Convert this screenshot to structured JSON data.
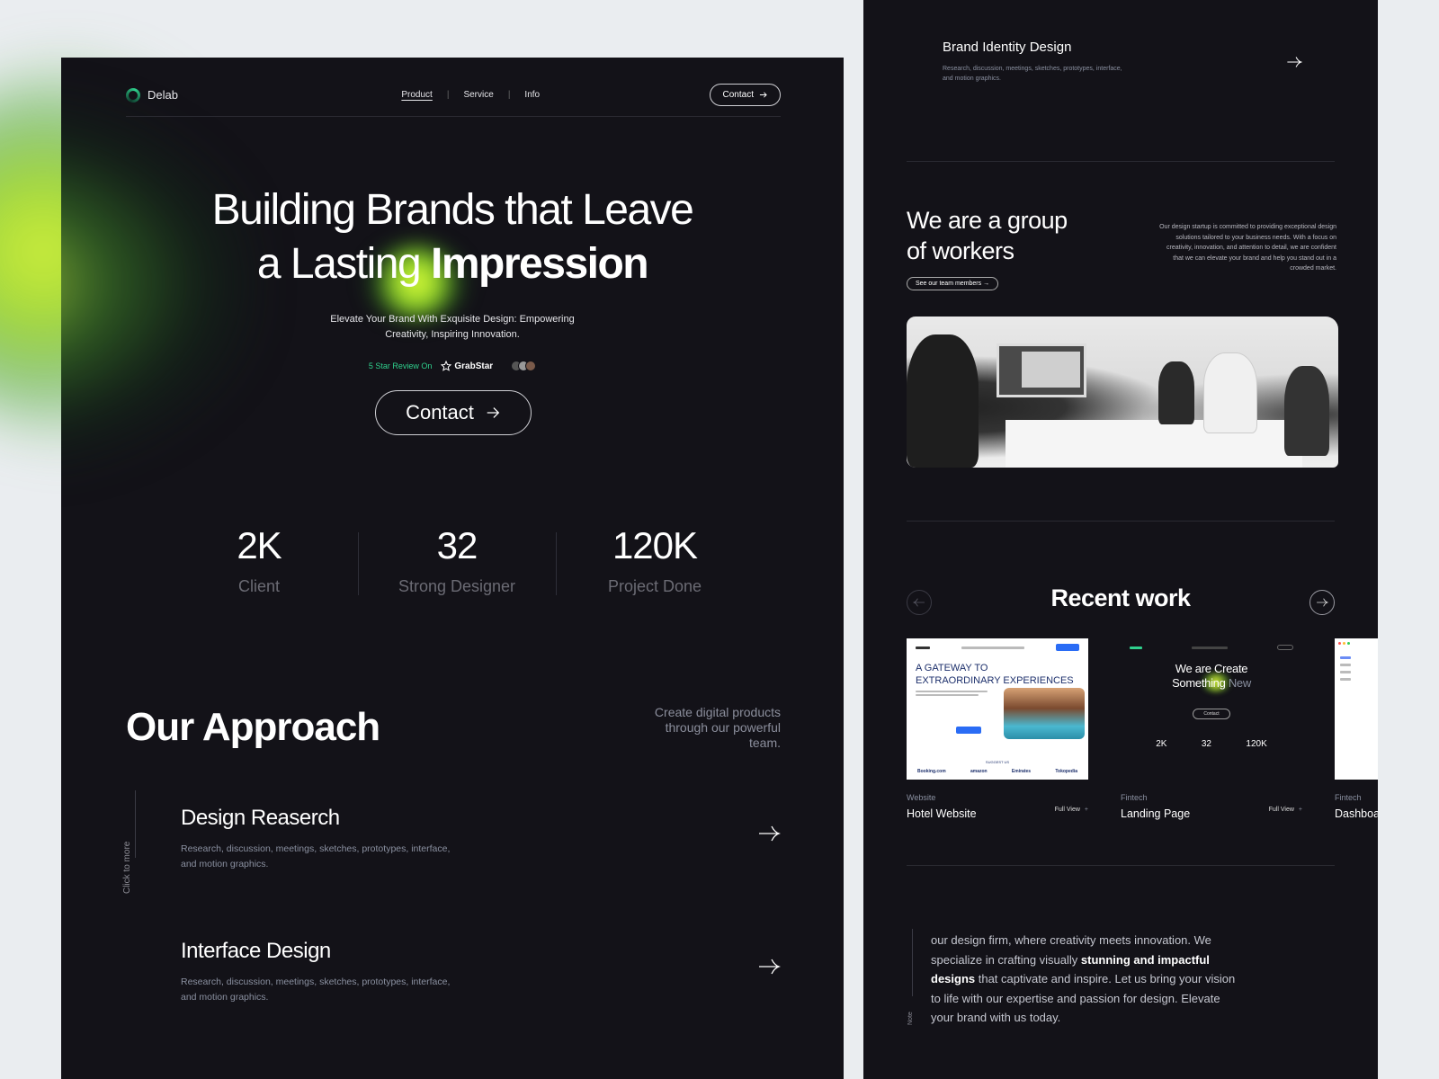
{
  "left_page": {
    "nav": {
      "brand": "Delab",
      "links": [
        {
          "label": "Product",
          "active": true
        },
        {
          "label": "Service",
          "active": false
        },
        {
          "label": "Info",
          "active": false
        }
      ],
      "separator": "|",
      "contact_label": "Contact",
      "contact_icon": "arrow-right-icon"
    },
    "hero": {
      "title_line1": "Building Brands that Leave",
      "title_line2_prefix": "a Lasting ",
      "title_line2_bold": "Impression",
      "subtitle_line1": "Elevate Your Brand With Exquisite Design: Empowering",
      "subtitle_line2": "Creativity, Inspiring Innovation.",
      "review_label": "5 Star Review On",
      "review_brand": "GrabStar",
      "contact_label": "Contact"
    },
    "stats": [
      {
        "value": "2K",
        "label": "Client"
      },
      {
        "value": "32",
        "label": "Strong Designer"
      },
      {
        "value": "120K",
        "label": "Project Done"
      }
    ],
    "approach": {
      "title": "Our Approach",
      "subtitle": "Create digital products through our powerful team.",
      "side_label": "Click to more",
      "services": [
        {
          "title": "Design Reaserch",
          "desc": "Research, discussion, meetings, sketches, prototypes, interface, and motion graphics."
        },
        {
          "title": "Interface Design",
          "desc": "Research, discussion, meetings, sketches, prototypes, interface, and motion graphics."
        }
      ]
    }
  },
  "right_page": {
    "service": {
      "title": "Brand Identity Design",
      "desc": "Research, discussion, meetings, sketches, prototypes, interface, and motion graphics."
    },
    "group": {
      "title_line1": "We are a group",
      "title_line2": "of workers",
      "button_label": "See our team members",
      "description": "Our design startup is committed to providing exceptional design solutions tailored to your business needs. With a focus on creativity, innovation, and attention to detail, we are confident that we can elevate your brand and help you stand out in a crowded market."
    },
    "recent_work": {
      "title": "Recent work",
      "prev_icon": "arrow-left-icon",
      "next_icon": "arrow-right-icon",
      "full_view_label": "Full View",
      "cards": [
        {
          "category": "Website",
          "name": "Hotel Website",
          "thumb": {
            "heading_line1": "A GATEWAY TO",
            "heading_line2": "EXTRAORDINARY EXPERIENCES",
            "section_label": "SUGGEST US",
            "logos": [
              "Booking.com",
              "amazon",
              "Emirates",
              "Tokopedia"
            ]
          }
        },
        {
          "category": "Fintech",
          "name": "Landing Page",
          "thumb": {
            "title_line1": "We are Create",
            "title_line2_a": "Something",
            "title_line2_b": " New",
            "contact_label": "Contact",
            "stats": [
              "2K",
              "32",
              "120K"
            ]
          }
        },
        {
          "category": "Fintech",
          "name": "Dashboard"
        }
      ]
    },
    "note": {
      "label": "Note",
      "text_part1": " our design firm, where creativity meets innovation. We specialize in crafting visually ",
      "text_bold": "stunning and impactful designs",
      "text_part2": " that captivate and inspire. Let us bring your vision to life with our expertise and passion for design. Elevate your brand with us today."
    }
  },
  "colors": {
    "background": "#eaedf0",
    "panel": "#131218",
    "accent_green": "#2fd08d",
    "accent_lime": "#d9f53d",
    "muted_text": "#8a90a0"
  }
}
